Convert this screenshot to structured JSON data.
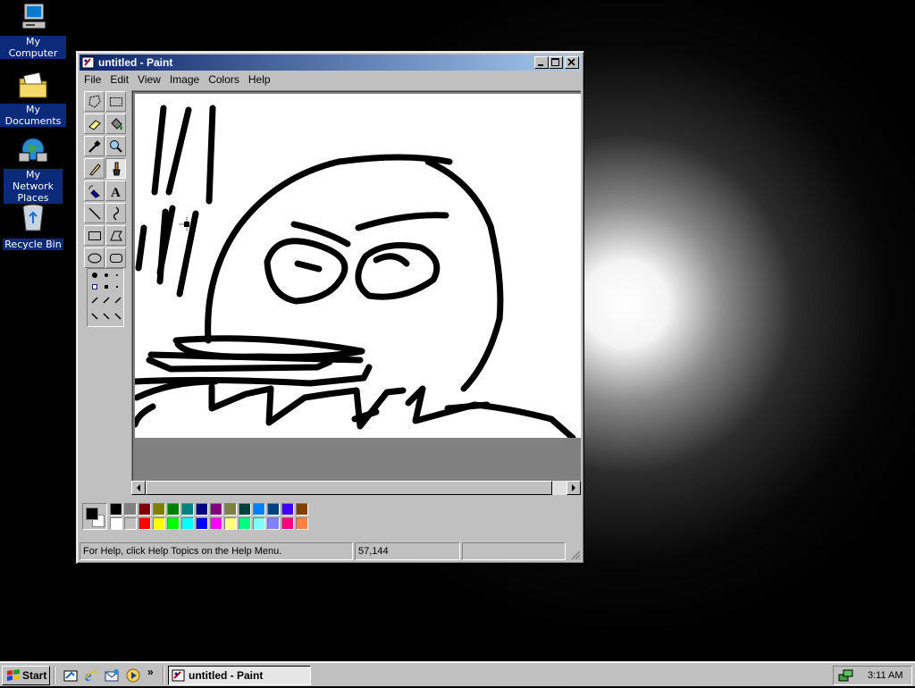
{
  "desktop": {
    "icons": [
      {
        "label": "My Computer"
      },
      {
        "label": "My Documents"
      },
      {
        "label": "My Network Places"
      },
      {
        "label": "Recycle Bin"
      }
    ]
  },
  "window": {
    "title": "untitled - Paint",
    "menu": [
      "File",
      "Edit",
      "View",
      "Image",
      "Colors",
      "Help"
    ],
    "tools": [
      "free-form-select",
      "select",
      "eraser",
      "fill-with-color",
      "pick-color",
      "magnifier",
      "pencil",
      "brush",
      "airbrush",
      "text",
      "line",
      "curve",
      "rectangle",
      "polygon",
      "ellipse",
      "rounded-rectangle"
    ],
    "selected_tool": "brush",
    "foreground_color": "#000000",
    "background_color": "#ffffff",
    "palette": [
      "#000000",
      "#808080",
      "#800000",
      "#808000",
      "#008000",
      "#008080",
      "#000080",
      "#800080",
      "#808040",
      "#004040",
      "#0080ff",
      "#004080",
      "#4000ff",
      "#804000",
      "#ffffff",
      "#c0c0c0",
      "#ff0000",
      "#ffff00",
      "#00ff00",
      "#00ffff",
      "#0000ff",
      "#ff00ff",
      "#ffff80",
      "#00ff80",
      "#80ffff",
      "#8080ff",
      "#ff0080",
      "#ff8040"
    ],
    "status": {
      "help": "For Help, click Help Topics on the Help Menu.",
      "coords": "57,144",
      "size": ""
    }
  },
  "taskbar": {
    "start_label": "Start",
    "quick_launch": [
      "show-desktop-icon",
      "internet-explorer-icon",
      "outlook-express-icon",
      "windows-media-icon"
    ],
    "task_label": "untitled - Paint",
    "clock": "3:11 AM"
  }
}
